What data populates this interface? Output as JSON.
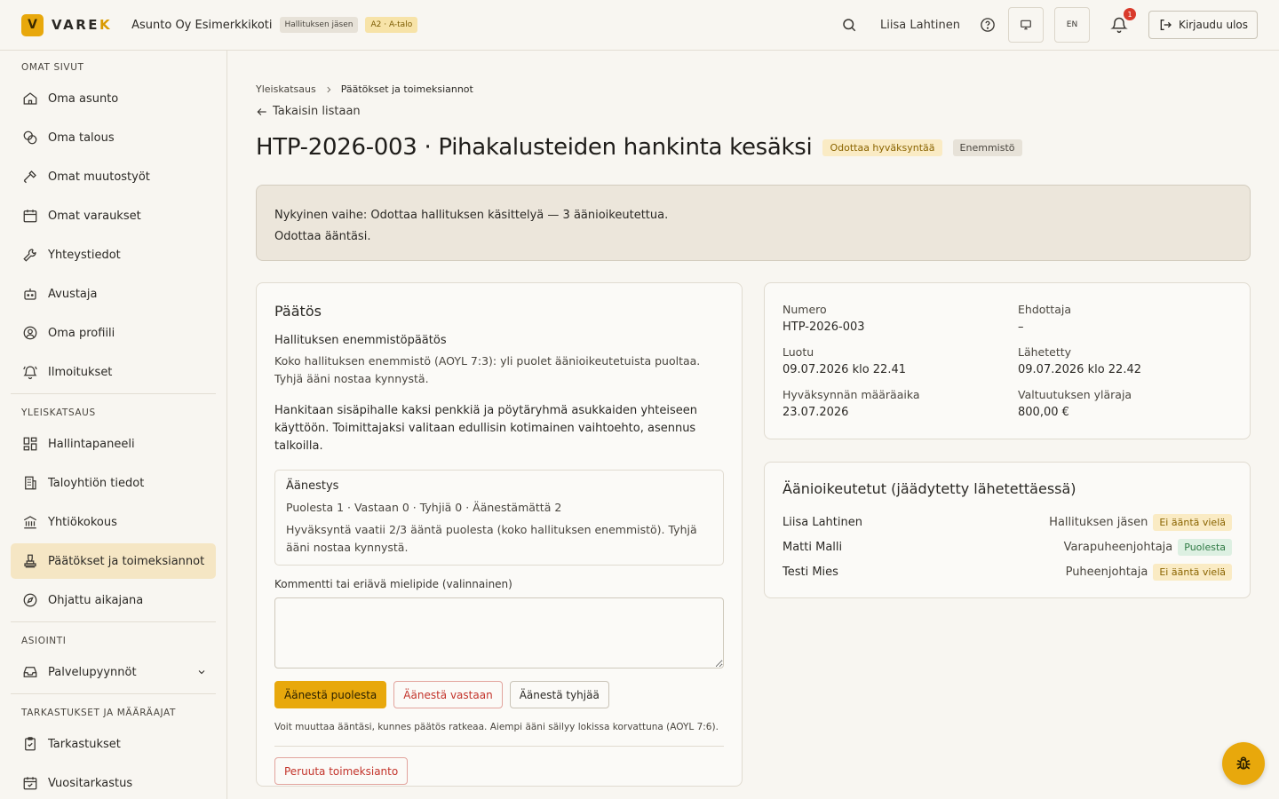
{
  "header": {
    "logo_mark": "V",
    "logo_text_main": "VARE",
    "logo_text_accent": "K",
    "org_name": "Asunto Oy Esimerkkikoti",
    "role_badge": "Hallituksen jäsen",
    "apartment_badge": "A2 · A-talo",
    "user_name": "Liisa Lahtinen",
    "lang_label": "EN",
    "notification_count": "1",
    "logout_label": "Kirjaudu ulos"
  },
  "sidebar": {
    "sections": [
      {
        "title": "OMAT SIVUT",
        "items": [
          {
            "label": "Oma asunto",
            "icon": "home-icon"
          },
          {
            "label": "Oma talous",
            "icon": "coins-icon"
          },
          {
            "label": "Omat muutostyöt",
            "icon": "hammer-icon"
          },
          {
            "label": "Omat varaukset",
            "icon": "calendar-icon"
          },
          {
            "label": "Yhteystiedot",
            "icon": "wrench-icon"
          },
          {
            "label": "Avustaja",
            "icon": "bot-icon"
          },
          {
            "label": "Oma profiili",
            "icon": "user-circle-icon"
          },
          {
            "label": "Ilmoitukset",
            "icon": "bell-ring-icon"
          }
        ]
      },
      {
        "title": "YLEISKATSAUS",
        "items": [
          {
            "label": "Hallintapaneeli",
            "icon": "dashboard-icon"
          },
          {
            "label": "Taloyhtiön tiedot",
            "icon": "building-icon"
          },
          {
            "label": "Yhtiökokous",
            "icon": "landmark-icon"
          },
          {
            "label": "Päätökset ja toimeksiannot",
            "icon": "stamp-icon",
            "active": true
          },
          {
            "label": "Ohjattu aikajana",
            "icon": "compass-icon"
          }
        ]
      },
      {
        "title": "ASIOINTI",
        "items": [
          {
            "label": "Palvelupyynnöt",
            "icon": "inbox-icon",
            "expandable": true
          }
        ]
      },
      {
        "title": "TARKASTUKSET JA MÄÄRÄAJAT",
        "items": [
          {
            "label": "Tarkastukset",
            "icon": "clipboard-check-icon"
          },
          {
            "label": "Vuositarkastus",
            "icon": "calendar-check-icon"
          }
        ]
      }
    ]
  },
  "breadcrumb": {
    "root": "Yleiskatsaus",
    "current": "Päätökset ja toimeksiannot"
  },
  "back_link": "Takaisin listaan",
  "page": {
    "title": "HTP-2026-003 · Pihakalusteiden hankinta kesäksi",
    "status_chip": "Odottaa hyväksyntää",
    "type_chip": "Enemmistö"
  },
  "stage": {
    "line1": "Nykyinen vaihe: Odottaa hallituksen käsittelyä — 3 äänioikeutettua.",
    "line2": "Odottaa ääntäsi."
  },
  "decision": {
    "heading": "Päätös",
    "subheading": "Hallituksen enemmistöpäätös",
    "rule_desc": "Koko hallituksen enemmistö (AOYL 7:3): yli puolet äänioikeutetuista puoltaa. Tyhjä ääni nostaa kynnystä.",
    "body": "Hankitaan sisäpihalle kaksi penkkiä ja pöytäryhmä asukkaiden yhteiseen käyttöön. Toimittajaksi valitaan edullisin kotimainen vaihtoehto, asennus talkoilla.",
    "voting": {
      "title": "Äänestys",
      "counts": "Puolesta 1 · Vastaan 0 · Tyhjiä 0 · Äänestämättä 2",
      "note": "Hyväksyntä vaatii 2/3 ääntä puolesta (koko hallituksen enemmistö). Tyhjä ääni nostaa kynnystä."
    },
    "comment_label": "Kommentti tai eriävä mielipide (valinnainen)",
    "comment_value": "",
    "btn_for": "Äänestä puolesta",
    "btn_against": "Äänestä vastaan",
    "btn_blank": "Äänestä tyhjää",
    "hint": "Voit muuttaa ääntäsi, kunnes päätös ratkeaa. Aiempi ääni säilyy lokissa korvattuna (AOYL 7:6).",
    "cancel_btn": "Peruuta toimeksianto"
  },
  "meta": {
    "number_label": "Numero",
    "number": "HTP-2026-003",
    "proposer_label": "Ehdottaja",
    "proposer": "–",
    "created_label": "Luotu",
    "created": "09.07.2026 klo 22.41",
    "sent_label": "Lähetetty",
    "sent": "09.07.2026 klo 22.42",
    "deadline_label": "Hyväksynnän määräaika",
    "deadline": "23.07.2026",
    "limit_label": "Valtuutuksen yläraja",
    "limit": "800,00 €"
  },
  "voters": {
    "heading": "Äänioikeutetut (jäädytetty lähetettäessä)",
    "rows": [
      {
        "name": "Liisa Lahtinen",
        "role": "Hallituksen jäsen",
        "status": "Ei ääntä vielä",
        "kind": "no-vote"
      },
      {
        "name": "Matti Malli",
        "role": "Varapuheenjohtaja",
        "status": "Puolesta",
        "kind": "for"
      },
      {
        "name": "Testi Mies",
        "role": "Puheenjohtaja",
        "status": "Ei ääntä vielä",
        "kind": "no-vote"
      }
    ]
  },
  "colors": {
    "accent": "#e8a80c",
    "active_nav": "#f5e6c4",
    "danger": "#c3342b",
    "success": "#2f7a44"
  }
}
